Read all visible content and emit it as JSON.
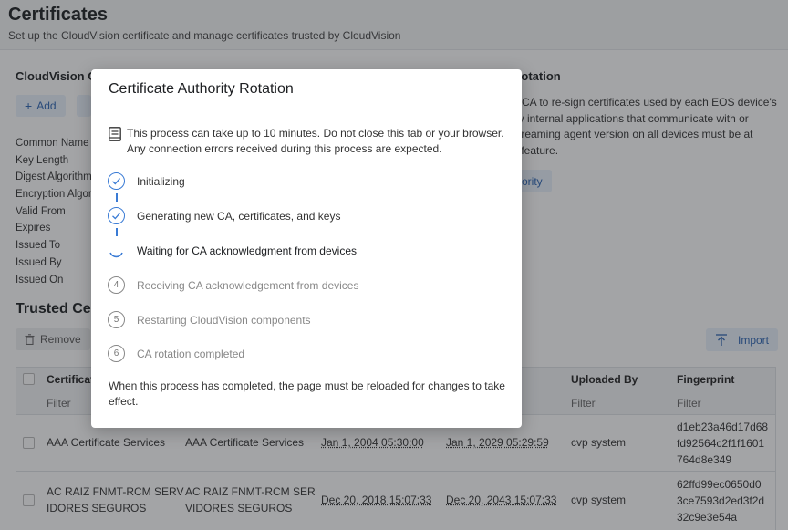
{
  "page": {
    "title": "Certificates",
    "subtitle": "Set up the CloudVision certificate and manage certificates trusted by CloudVision"
  },
  "cv_cert": {
    "section_title": "CloudVision C",
    "add_label": "Add",
    "fields": [
      "Common Name",
      "Key Length",
      "Digest Algorithm",
      "Encryption Algor",
      "Valid From",
      "Expires",
      "Issued To",
      "Issued By",
      "Issued On"
    ]
  },
  "rotation": {
    "section_title": "Rotation",
    "text_lines": [
      "n CA to re-sign certificates used by each EOS device's",
      "by internal applications that communicate with or",
      "streaming agent version on all devices must be at",
      "s feature."
    ],
    "button_label": "ority"
  },
  "trusted": {
    "section_title": "Trusted Cer",
    "remove_label": "Remove",
    "import_label": "Import",
    "columns": [
      {
        "label": "Certificat",
        "filter": "Filter"
      },
      {
        "label": "Uploaded By",
        "filter": "Filter"
      },
      {
        "label": "Fingerprint",
        "filter": "Filter"
      }
    ],
    "rows": [
      {
        "name": [
          "AAA Certificate Services"
        ],
        "issuer": [
          "AAA Certificate Services"
        ],
        "valid_from": "Jan 1, 2004 05:30:00",
        "expires": "Jan 1, 2029 05:29:59",
        "uploaded_by": "cvp system",
        "fingerprint": [
          "d1eb23a46d17d68",
          "fd92564c2f1f1601",
          "764d8e349"
        ]
      },
      {
        "name": [
          "AC RAIZ FNMT-RCM SERV",
          "IDORES SEGUROS"
        ],
        "issuer": [
          "AC RAIZ FNMT-RCM SER",
          "VIDORES SEGUROS"
        ],
        "valid_from": "Dec 20, 2018 15:07:33",
        "expires": "Dec 20, 2043 15:07:33",
        "uploaded_by": "cvp system",
        "fingerprint": [
          "62ffd99ec0650d0",
          "3ce7593d2ed3f2d",
          "32c9e3e54a"
        ]
      }
    ]
  },
  "modal": {
    "title": "Certificate Authority Rotation",
    "notice_lines": [
      "This process can take up to 10 minutes. Do not close this tab or your browser.",
      "Any connection errors received during this process are expected."
    ],
    "steps": [
      {
        "label": "Initializing",
        "status": "done"
      },
      {
        "label": "Generating new CA, certificates, and keys",
        "status": "done"
      },
      {
        "label": "Waiting for CA acknowledgment from devices",
        "status": "active"
      },
      {
        "label": "Receiving CA acknowledgement from devices",
        "status": "pending",
        "number": "4"
      },
      {
        "label": "Restarting CloudVision components",
        "status": "pending",
        "number": "5"
      },
      {
        "label": "CA rotation completed",
        "status": "pending",
        "number": "6"
      }
    ],
    "footer_lines": [
      "When this process has completed, the page must be reloaded for changes to take",
      "effect."
    ]
  },
  "colors": {
    "accent": "#3a7bd5",
    "overlay": "rgba(35,38,44,0.42)"
  }
}
